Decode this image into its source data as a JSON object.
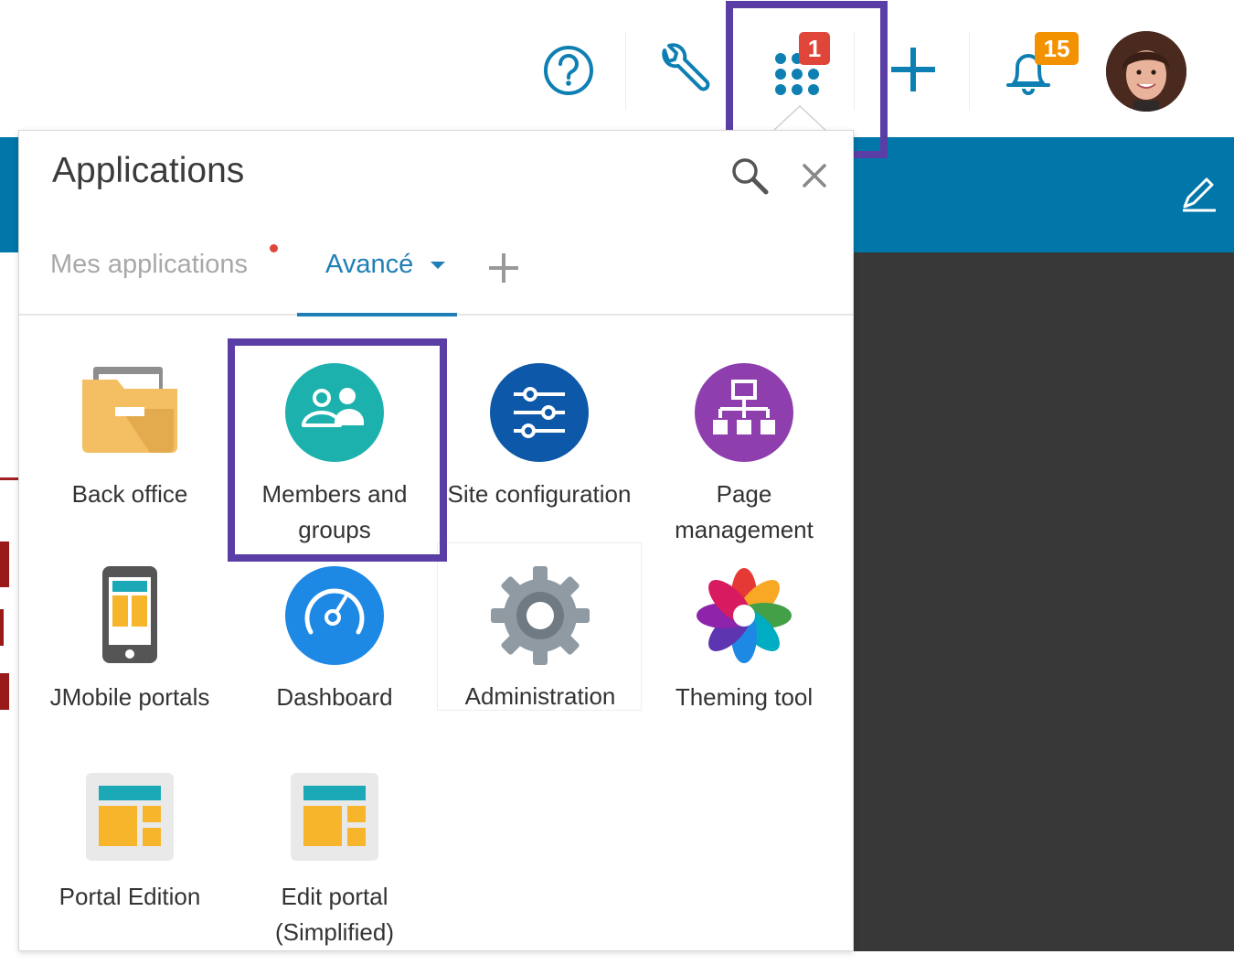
{
  "header": {
    "apps_badge": "1",
    "notifications_badge": "15"
  },
  "panel": {
    "title": "Applications",
    "tabs": [
      {
        "label": "Mes applications"
      },
      {
        "label": "Avancé"
      }
    ]
  },
  "apps": [
    {
      "label": "Back office"
    },
    {
      "label": "Members and groups"
    },
    {
      "label": "Site configuration"
    },
    {
      "label": "Page management"
    },
    {
      "label": "JMobile portals"
    },
    {
      "label": "Dashboard"
    },
    {
      "label": "Administration"
    },
    {
      "label": "Theming tool"
    },
    {
      "label": "Portal Edition"
    },
    {
      "label": "Edit portal (Simplified)"
    }
  ],
  "colors": {
    "accent": "#1f7fb6",
    "header_blue": "#0077a8",
    "highlight": "#5a3ea6",
    "badge_red": "#e0453a",
    "badge_orange": "#f39200"
  }
}
